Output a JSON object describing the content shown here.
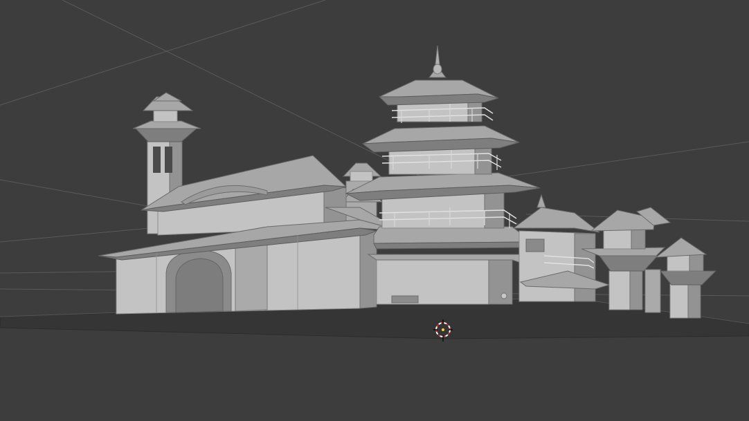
{
  "viewport": {
    "mode": "3d-viewport",
    "shading": "solid",
    "background_color": "#3d3d3d",
    "model_color": "#c3c3c3",
    "ground_color": "#3a3a3a"
  },
  "scene_objects": [
    {
      "name": "gate-building"
    },
    {
      "name": "minaret-tower"
    },
    {
      "name": "pagoda-tower"
    },
    {
      "name": "side-pavilion"
    },
    {
      "name": "lantern-pillars"
    },
    {
      "name": "ground-plane"
    }
  ],
  "cursor_3d": {
    "icon": "3d-cursor-icon",
    "colors": [
      "#ffffff",
      "#d12a2a"
    ]
  }
}
